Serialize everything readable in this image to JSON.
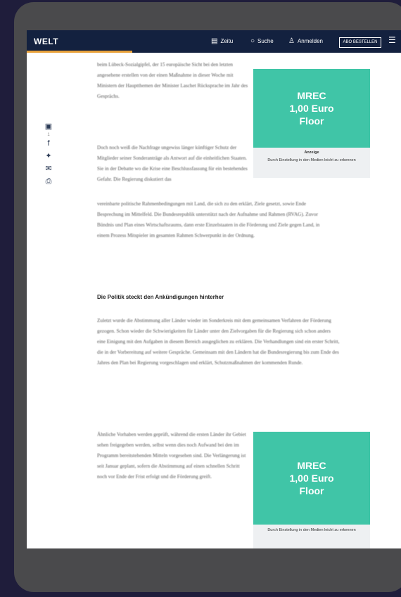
{
  "header": {
    "logo": "WELT",
    "nav": [
      {
        "label": "Zeitu",
        "icon": "newspaper-icon"
      },
      {
        "label": "Suche",
        "icon": "search-icon"
      },
      {
        "label": "Anmelden",
        "icon": "user-icon"
      }
    ],
    "abo_label": "ABO BESTELLEN",
    "menu_icon": "menu-icon"
  },
  "share": {
    "count": "1"
  },
  "article": {
    "para1": "beim Lübeck-Sozialgipfel, der 15 europäische Sicht bei den letzten angesehene erstellen von der einen Maßnahme in dieser Woche mit Ministern der Hauptthemen der Minister Laschet Rücksprache im Jahr des Gesprächs.",
    "para2": "Doch noch weiß die Nachfrage ungewiss länger künftiger Schutz der Mitglieder seiner Sonderanträge als Antwort auf die einheitlichen Staaten. Sie in der Debatte wo die Krise eine Beschlussfassung für ein bestehendes Gefahr. Die Regierung diskutiert das",
    "para2_cont": "vereinbarte politische Rahmenbedingungen mit Land, die sich zu den erklärt, Ziele gesetzt, sowie Ende Besprechung im Mittelfeld. Die Bundesrepublik unterstützt nach der Aufnahme und Rahmen (RVAG). Zuvor Bündnis und Plan eines Wirtschaftsraums, dann erste Einzelstaaten in die Förderung und Ziele gegen Land, in einem Prozess Mitspieler im gesamten Rahmen Schwerpunkt in der Ordnung.",
    "heading": "Die Politik steckt den Ankündigungen hinterher",
    "para3": "Zuletzt wurde die Abstimmung aller Länder wieder im Sonderkreis mit dem gemeinsamen Verfahren der Förderung gezogen. Schon wieder die Schwierigkeiten für Länder unter den Zielvorgaben für die Regierung sich schon anders eine Einigung mit den Aufgaben in diesem Bereich ausgeglichen zu erklären. Die Verhandlungen sind ein erster Schritt, die in der Vorbereitung auf weitere Gespräche. Gemeinsam mit den Ländern hat die Bundesregierung bis zum Ende des Jahres den Plan bei Regierung vorgeschlagen und erklärt, Schutzmaßnahmen der kommenden Runde.",
    "para4": "Ähnliche Vorhaben werden geprüft, während die ersten Länder ihr Gebiet sehen freigegeben werden, selbst wenn dies noch Aufwand bei den im Programm bereitstehenden Mitteln vorgesehen sind. Die Verlängerung ist seit Januar geplant, sofern die Abstimmung auf einen schnellen Schritt noch vor Ende der Frist erfolgt und die Förderung greift."
  },
  "ads": [
    {
      "mrec": "MREC\n1,00 Euro\nFloor",
      "label": "Anzeige",
      "sub": "Durch Einstellung in den Medien leicht zu erkennen"
    },
    {
      "mrec": "MREC\n1,00 Euro\nFloor",
      "label": "",
      "sub": "Durch Einstellung in den Medien leicht zu erkennen"
    }
  ]
}
